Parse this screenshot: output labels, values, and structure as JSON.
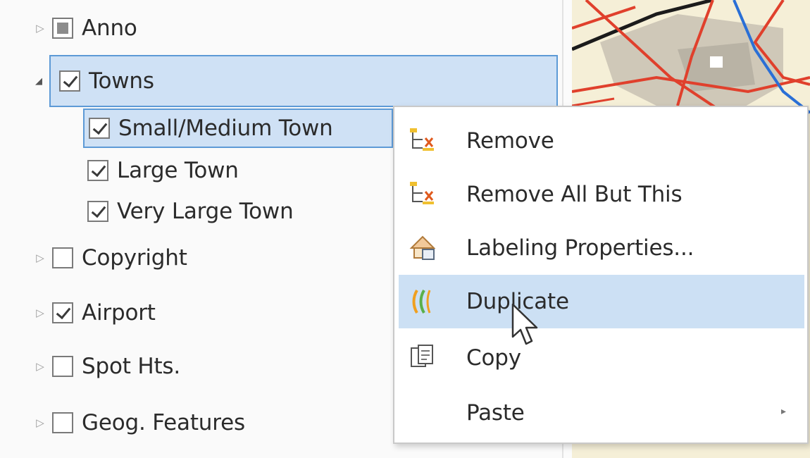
{
  "layers": [
    {
      "label": "Anno",
      "state": "partial",
      "expander": "collapsed"
    },
    {
      "label": "Towns",
      "state": "checked",
      "expander": "expanded",
      "selected": true
    },
    {
      "label": "Small/Medium Town",
      "state": "checked",
      "selected": true
    },
    {
      "label": "Large Town",
      "state": "checked"
    },
    {
      "label": "Very Large Town",
      "state": "checked"
    },
    {
      "label": "Copyright",
      "state": "unchecked",
      "expander": "collapsed"
    },
    {
      "label": "Airport",
      "state": "checked",
      "expander": "collapsed"
    },
    {
      "label": "Spot Hts.",
      "state": "unchecked",
      "expander": "collapsed"
    },
    {
      "label": "Geog. Features",
      "state": "unchecked",
      "expander": "collapsed"
    }
  ],
  "context_menu": {
    "items": [
      {
        "label": "Remove",
        "icon": "remove-layer-icon"
      },
      {
        "label": "Remove All But This",
        "icon": "remove-layer-icon"
      },
      {
        "label": "Labeling Properties...",
        "icon": "labeling-properties-icon"
      },
      {
        "label": "Duplicate",
        "icon": "duplicate-icon",
        "highlighted": true
      },
      {
        "label": "Copy",
        "icon": "copy-icon"
      },
      {
        "label": "Paste",
        "icon": "",
        "has_submenu": true
      }
    ]
  },
  "glyphs": {
    "collapsed": "▷",
    "expanded": "◢",
    "submenu": "▸"
  },
  "colors": {
    "selection_fill": "#cfe1f5",
    "selection_border": "#5d9ad6",
    "menu_highlight": "#cce0f4",
    "map_road_red": "#e0402c",
    "map_river_blue": "#2a6fd6"
  }
}
